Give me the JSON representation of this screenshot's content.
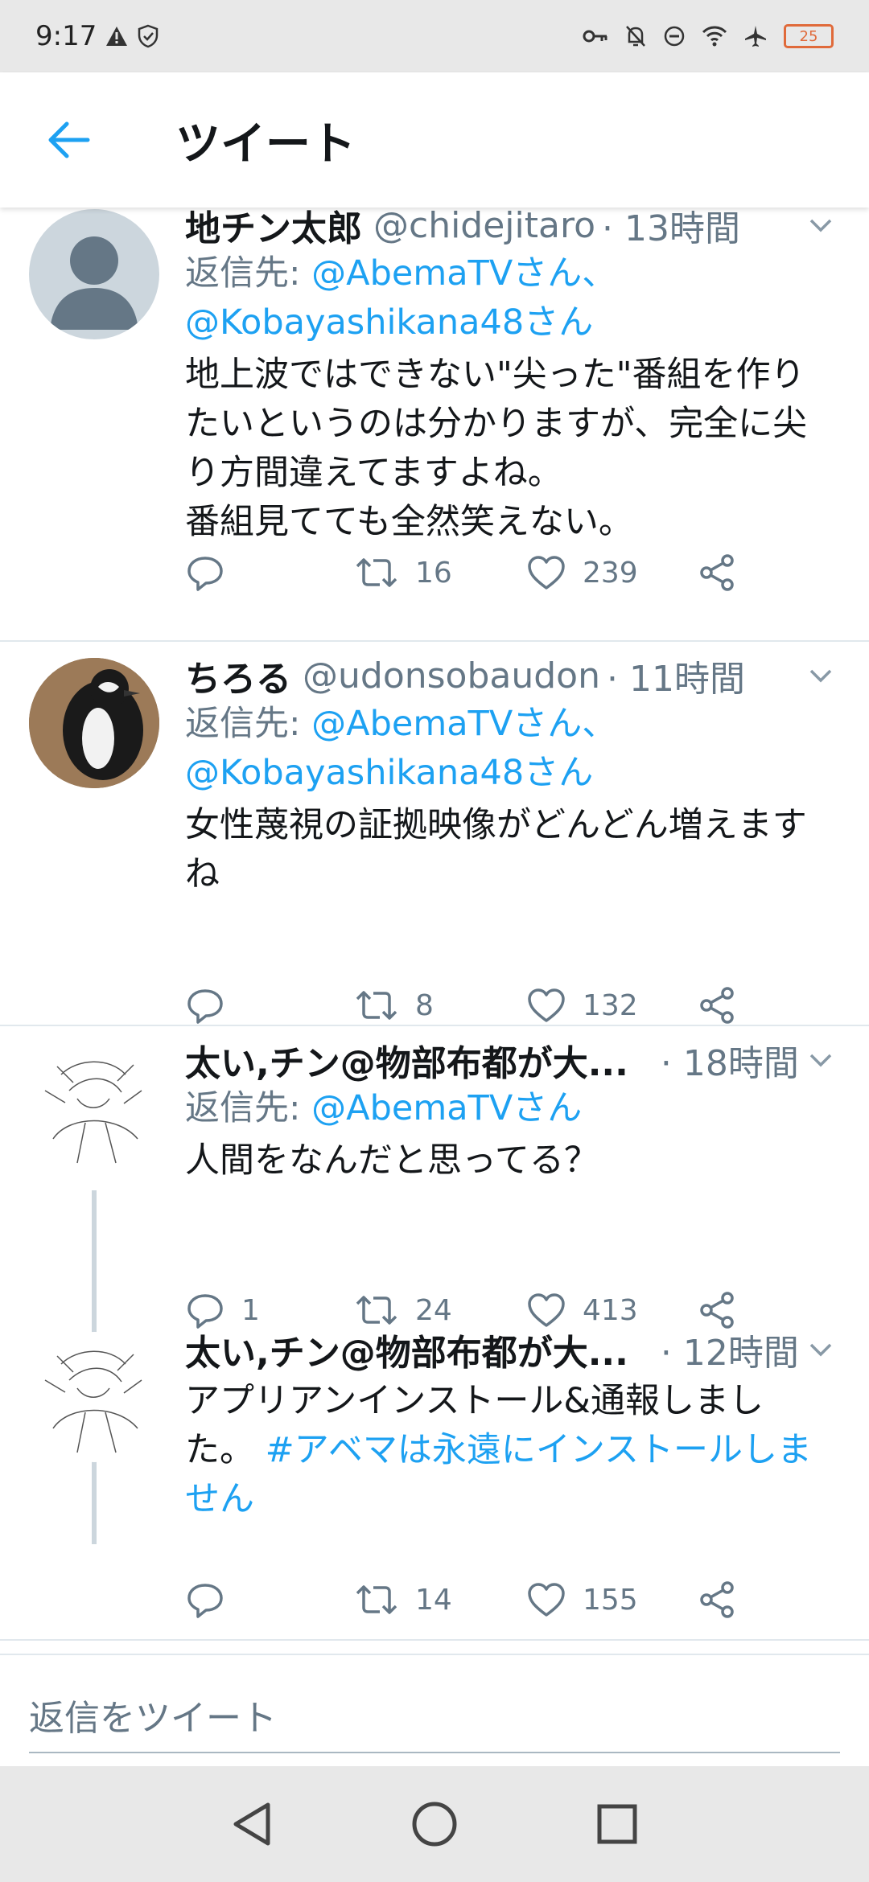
{
  "status_bar": {
    "time": "9:17",
    "battery": "25"
  },
  "app_bar": {
    "title": "ツイート"
  },
  "tweets": [
    {
      "name": "地チン太郎",
      "handle": "@chidejitaro",
      "time": "· 13時間",
      "reply_prefix": "返信先: ",
      "reply_mentions_line1": "@AbemaTVさん、",
      "reply_mentions_line2": "@Kobayashikana48さん",
      "text_lines": [
        "地上波ではできない\"尖った\"番組を作り",
        "たいというのは分かりますが、完全に尖",
        "り方間違えてますよね。",
        "番組見てても全然笑えない。"
      ],
      "replies": "",
      "retweets": "16",
      "likes": "239"
    },
    {
      "name": "ちろる",
      "handle": "@udonsobaudon",
      "time": "· 11時間",
      "reply_prefix": "返信先: ",
      "reply_mentions_line1": "@AbemaTVさん、",
      "reply_mentions_line2": "@Kobayashikana48さん",
      "text_lines": [
        "女性蔑視の証拠映像がどんどん増えます",
        "ね"
      ],
      "replies": "",
      "retweets": "8",
      "likes": "132"
    },
    {
      "name": "太い,チン@物部布都が大...",
      "handle": "",
      "time": "· 18時間",
      "reply_prefix": "返信先: ",
      "reply_mentions_line1": "@AbemaTVさん",
      "text_lines": [
        "人間をなんだと思ってる？"
      ],
      "replies": "1",
      "retweets": "24",
      "likes": "413"
    },
    {
      "name": "太い,チン@物部布都が大...",
      "handle": "",
      "time": "· 12時間",
      "text_line1": "アプリアンインストール&通報しまし",
      "text_line2_plain": "た。",
      "hashtag_part1": "#アベマは永遠にインストールしま",
      "hashtag_part2": "せん",
      "replies": "",
      "retweets": "14",
      "likes": "155"
    }
  ],
  "composer": {
    "placeholder": "返信をツイート"
  },
  "colors": {
    "accent": "#1da1f2",
    "secondary_text": "#657786",
    "primary_text": "#14171a"
  }
}
